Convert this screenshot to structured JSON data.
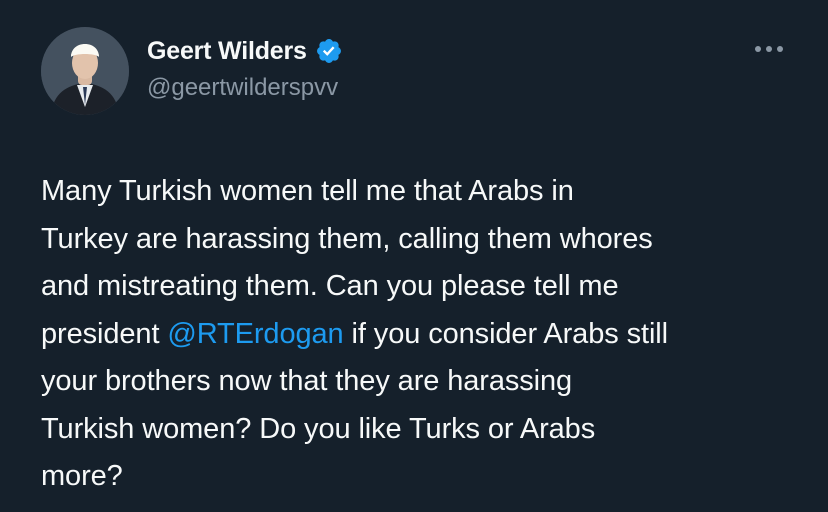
{
  "author": {
    "display_name": "Geert Wilders",
    "handle": "@geertwilderspvv",
    "verified": true,
    "avatar_icon": "profile-photo",
    "verified_icon": "verified-badge-icon",
    "verified_color": "#1d9bf0"
  },
  "menu": {
    "icon": "more-options-icon"
  },
  "tweet": {
    "lines": [
      {
        "text": "Many Turkish women tell me that Arabs in"
      },
      {
        "text": "Turkey are harassing them, calling them whores"
      },
      {
        "text": "and mistreating them. Can you please tell me"
      },
      {
        "before": "president ",
        "mention": "@RTErdogan",
        "after": " if you consider Arabs still"
      },
      {
        "text": "your brothers now that they are harassing"
      },
      {
        "text": "Turkish women? Do you like Turks or Arabs"
      },
      {
        "text": "more?"
      }
    ]
  },
  "colors": {
    "background": "#15202b",
    "text": "#f7f9f9",
    "secondary_text": "#8b98a5",
    "link": "#1d9bf0"
  }
}
